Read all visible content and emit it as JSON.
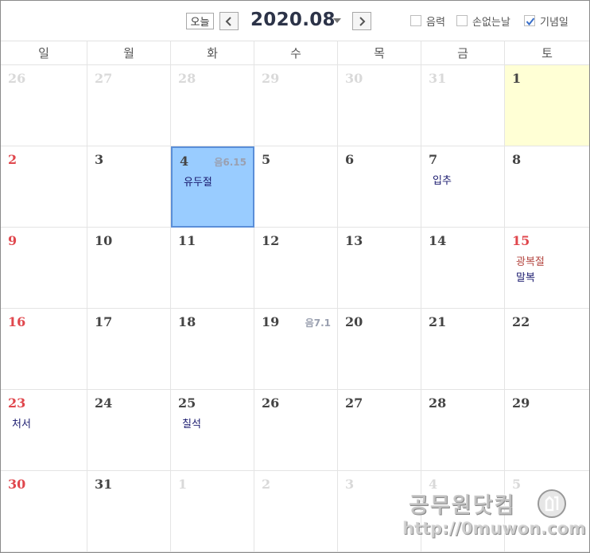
{
  "header": {
    "today_label": "오늘",
    "title": "2020.08",
    "options": [
      {
        "label": "음력",
        "checked": false
      },
      {
        "label": "손없는날",
        "checked": false
      },
      {
        "label": "기념일",
        "checked": true
      }
    ]
  },
  "weekdays": [
    "일",
    "월",
    "화",
    "수",
    "목",
    "금",
    "토"
  ],
  "weeks": [
    [
      {
        "day": "26",
        "type": "other"
      },
      {
        "day": "27",
        "type": "other"
      },
      {
        "day": "28",
        "type": "other"
      },
      {
        "day": "29",
        "type": "other"
      },
      {
        "day": "30",
        "type": "other"
      },
      {
        "day": "31",
        "type": "other"
      },
      {
        "day": "1",
        "type": "normal",
        "highlight": true
      }
    ],
    [
      {
        "day": "2",
        "type": "sun"
      },
      {
        "day": "3",
        "type": "normal"
      },
      {
        "day": "4",
        "type": "normal",
        "selected": true,
        "lunar": "음6.15",
        "events": [
          {
            "text": "유두절",
            "holiday": false
          }
        ]
      },
      {
        "day": "5",
        "type": "normal"
      },
      {
        "day": "6",
        "type": "normal"
      },
      {
        "day": "7",
        "type": "normal",
        "events": [
          {
            "text": "입추",
            "holiday": false
          }
        ]
      },
      {
        "day": "8",
        "type": "normal"
      }
    ],
    [
      {
        "day": "9",
        "type": "sun"
      },
      {
        "day": "10",
        "type": "normal"
      },
      {
        "day": "11",
        "type": "normal"
      },
      {
        "day": "12",
        "type": "normal"
      },
      {
        "day": "13",
        "type": "normal"
      },
      {
        "day": "14",
        "type": "normal"
      },
      {
        "day": "15",
        "type": "sun",
        "events": [
          {
            "text": "광복절",
            "holiday": true
          },
          {
            "text": "말복",
            "holiday": false
          }
        ]
      }
    ],
    [
      {
        "day": "16",
        "type": "sun"
      },
      {
        "day": "17",
        "type": "normal"
      },
      {
        "day": "18",
        "type": "normal"
      },
      {
        "day": "19",
        "type": "normal",
        "lunar": "음7.1"
      },
      {
        "day": "20",
        "type": "normal"
      },
      {
        "day": "21",
        "type": "normal"
      },
      {
        "day": "22",
        "type": "normal"
      }
    ],
    [
      {
        "day": "23",
        "type": "sun",
        "events": [
          {
            "text": "처서",
            "holiday": false
          }
        ]
      },
      {
        "day": "24",
        "type": "normal"
      },
      {
        "day": "25",
        "type": "normal",
        "events": [
          {
            "text": "칠석",
            "holiday": false
          }
        ]
      },
      {
        "day": "26",
        "type": "normal"
      },
      {
        "day": "27",
        "type": "normal"
      },
      {
        "day": "28",
        "type": "normal"
      },
      {
        "day": "29",
        "type": "normal"
      }
    ],
    [
      {
        "day": "30",
        "type": "sun"
      },
      {
        "day": "31",
        "type": "normal"
      },
      {
        "day": "1",
        "type": "other"
      },
      {
        "day": "2",
        "type": "other"
      },
      {
        "day": "3",
        "type": "other"
      },
      {
        "day": "4",
        "type": "other"
      },
      {
        "day": "5",
        "type": "other"
      }
    ]
  ],
  "watermark": {
    "text": "공무원닷컴",
    "url": "http://0muwon.com"
  }
}
